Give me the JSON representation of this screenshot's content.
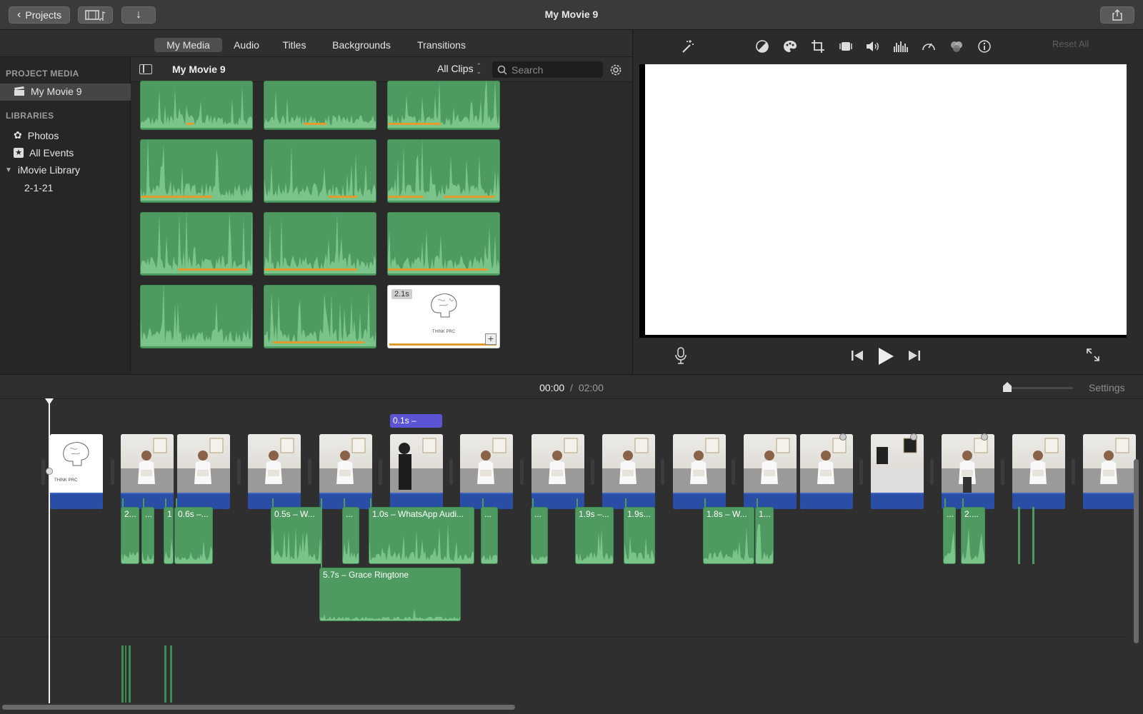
{
  "window": {
    "title": "My Movie 9"
  },
  "toolbar": {
    "projects_label": "Projects"
  },
  "media_tabs": [
    {
      "label": "My Media",
      "active": true
    },
    {
      "label": "Audio",
      "active": false
    },
    {
      "label": "Titles",
      "active": false
    },
    {
      "label": "Backgrounds",
      "active": false
    },
    {
      "label": "Transitions",
      "active": false
    }
  ],
  "sidebar": {
    "project_media_heading": "PROJECT MEDIA",
    "project_item": "My Movie 9",
    "libraries_heading": "LIBRARIES",
    "photos": "Photos",
    "all_events": "All Events",
    "library": "iMovie Library",
    "event": "2-1-21"
  },
  "browser": {
    "title": "My Movie 9",
    "filter": "All Clips",
    "search_placeholder": "Search",
    "title_clip_duration": "2.1s",
    "title_clip_text": "THINK PRC"
  },
  "viewer": {
    "reset_all": "Reset All"
  },
  "timeline": {
    "current_time": "00:00",
    "separator": "/",
    "total_time": "02:00",
    "settings_label": "Settings",
    "transition_label": "0.1s –",
    "title_clip_text": "THINK PRC",
    "audio_labels": {
      "a1": "2...",
      "a2": "...",
      "a3": "1",
      "a4": "0.6s –...",
      "a5": "0.5s – W...",
      "a6": "...",
      "a7": "1.0s – WhatsApp Audi...",
      "a8": "...",
      "a9": "...",
      "a10": "1.9s –...",
      "a11": "1.9s...",
      "a12": "1.8s – W...",
      "a13": "1...",
      "a14": "...",
      "a15": "2....",
      "ringtone": "5.7s – Grace Ringtone"
    }
  },
  "colors": {
    "audio_green": "#4e9a61",
    "video_band_blue": "#2a4ea6",
    "orange_bar": "#e49a2c",
    "transition_purple": "#5b55d6"
  }
}
